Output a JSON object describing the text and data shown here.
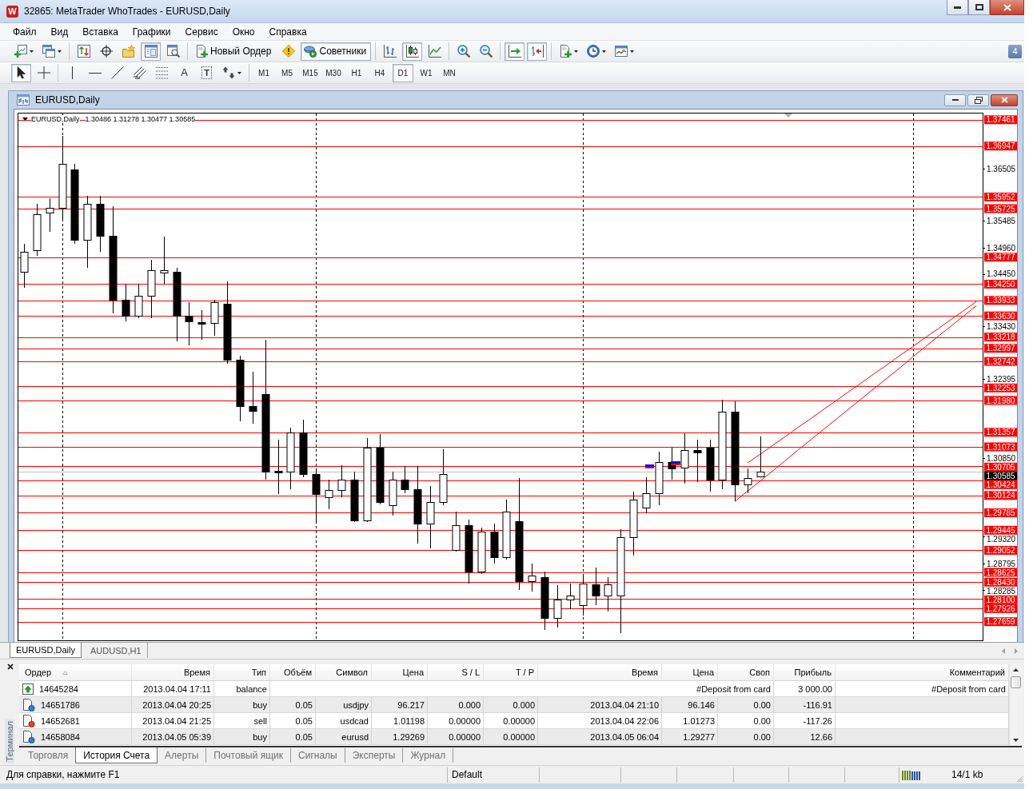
{
  "window": {
    "logo": "W",
    "title": "32865: MetaTrader WhoTrades - EURUSD,Daily"
  },
  "menu": [
    "Файл",
    "Вид",
    "Вставка",
    "Графики",
    "Сервис",
    "Окно",
    "Справка"
  ],
  "toolbar": {
    "groups": [
      [
        {
          "pressed": false
        },
        {
          "pressed": false
        }
      ],
      [
        {
          "pressed": false
        },
        {
          "pressed": false
        },
        {
          "pressed": false
        },
        {
          "pressed": true
        },
        {
          "pressed": false
        }
      ],
      [
        {
          "label": "Новый Ордер",
          "pressed": false
        },
        {
          "pressed": false
        },
        {
          "label": "Советники",
          "pressed": true
        }
      ],
      [
        {
          "pressed": false
        },
        {
          "pressed": true
        },
        {
          "pressed": false
        }
      ],
      [
        {
          "pressed": false
        },
        {
          "pressed": false
        }
      ],
      [
        {
          "pressed": true
        },
        {
          "pressed": true
        }
      ],
      [
        {
          "pressed": false
        },
        {
          "pressed": false
        },
        {
          "pressed": false
        }
      ]
    ],
    "badge": "4"
  },
  "drawing_toolbar": {
    "groups": [
      [
        {
          "pressed": true
        },
        {
          "pressed": false
        }
      ],
      [
        {
          "pressed": false
        },
        {
          "pressed": false
        },
        {
          "pressed": false
        },
        {
          "pressed": false
        },
        {
          "pressed": false
        },
        {
          "glyph": "A",
          "pressed": false
        },
        {
          "glyph": "T",
          "pressed": false
        },
        {
          "pressed": false
        }
      ]
    ],
    "timeframes": [
      {
        "label": "M1",
        "selected": false
      },
      {
        "label": "M5",
        "selected": false
      },
      {
        "label": "M15",
        "selected": false
      },
      {
        "label": "M30",
        "selected": false
      },
      {
        "label": "H1",
        "selected": false
      },
      {
        "label": "H4",
        "selected": false
      },
      {
        "label": "D1",
        "selected": true
      },
      {
        "label": "W1",
        "selected": false
      },
      {
        "label": "MN",
        "selected": false
      }
    ]
  },
  "chart_window": {
    "title": "EURUSD,Daily",
    "chart_data": [
      {
        "type": "candlestick",
        "title": "EURUSD,Daily",
        "subtitle": "1.30486 1.31278 1.30477 1.30585",
        "categories": [
          null,
          null,
          null,
          null,
          null,
          null,
          null,
          null,
          null,
          null,
          null,
          null,
          null,
          null,
          null,
          null,
          null,
          null,
          null,
          null,
          null,
          null,
          null,
          null,
          null,
          null,
          null,
          null,
          null,
          null,
          null,
          null,
          null,
          null,
          null,
          null,
          null,
          null,
          null,
          null,
          null,
          null,
          null,
          null,
          null,
          null,
          null,
          null,
          null,
          null,
          null,
          null,
          null,
          null,
          null,
          null,
          null,
          null,
          null,
          null,
          null,
          null,
          null,
          null,
          null,
          null,
          null,
          null,
          null,
          null,
          null,
          null,
          null,
          null,
          null,
          null
        ],
        "ohlc": [
          [
            1.34491,
            1.35038,
            1.34179,
            1.34882
          ],
          [
            1.34913,
            1.35818,
            1.34804,
            1.35615
          ],
          [
            1.35647,
            1.35928,
            1.35272,
            1.3574
          ],
          [
            1.3574,
            1.37145,
            1.35506,
            1.36599
          ],
          [
            1.3649,
            1.36599,
            1.35038,
            1.35116
          ],
          [
            1.35116,
            1.35974,
            1.3457,
            1.35818
          ],
          [
            1.35818,
            1.35974,
            1.34882,
            1.35194
          ],
          [
            1.35194,
            1.35771,
            1.3368,
            1.33945
          ],
          [
            1.33945,
            1.34257,
            1.33523,
            1.33633
          ],
          [
            1.33633,
            1.34257,
            1.33586,
            1.34023
          ],
          [
            1.34023,
            1.34725,
            1.33586,
            1.34523
          ],
          [
            1.34476,
            1.35178,
            1.34257,
            1.34523
          ],
          [
            1.34491,
            1.3457,
            1.33133,
            1.33633
          ],
          [
            1.33633,
            1.33898,
            1.33055,
            1.33523
          ],
          [
            1.33508,
            1.33742,
            1.33164,
            1.33477
          ],
          [
            1.33492,
            1.33945,
            1.33243,
            1.33898
          ],
          [
            1.33867,
            1.34304,
            1.32696,
            1.32774
          ],
          [
            1.32774,
            1.32852,
            1.31572,
            1.31869
          ],
          [
            1.31869,
            1.3254,
            1.31525,
            1.31775
          ],
          [
            1.32103,
            1.33164,
            1.30433,
            1.30589
          ],
          [
            1.30604,
            1.31213,
            1.30152,
            1.30573
          ],
          [
            1.30589,
            1.31447,
            1.30245,
            1.31354
          ],
          [
            1.31354,
            1.31603,
            1.3048,
            1.30542
          ],
          [
            1.30542,
            1.3062,
            1.29621,
            1.30152
          ],
          [
            1.30089,
            1.30433,
            1.29855,
            1.3023
          ],
          [
            1.3023,
            1.30714,
            1.30089,
            1.30433
          ],
          [
            1.30433,
            1.30589,
            1.29605,
            1.29637
          ],
          [
            1.29637,
            1.31245,
            1.29605,
            1.31057
          ],
          [
            1.31057,
            1.31323,
            1.29949,
            1.29996
          ],
          [
            1.29933,
            1.30589,
            1.2973,
            1.30433
          ],
          [
            1.30433,
            1.30698,
            1.30168,
            1.30245
          ],
          [
            1.30245,
            1.30698,
            1.29184,
            1.29574
          ],
          [
            1.29574,
            1.30308,
            1.2909,
            1.29996
          ],
          [
            1.29996,
            1.31026,
            1.29933,
            1.30542
          ],
          [
            1.29059,
            1.29808,
            1.29028,
            1.29543
          ],
          [
            1.29543,
            1.29652,
            1.28403,
            1.28638
          ],
          [
            1.28638,
            1.29496,
            1.28591,
            1.29418
          ],
          [
            1.29418,
            1.29574,
            1.28794,
            1.28918
          ],
          [
            1.28918,
            1.30043,
            1.28872,
            1.29808
          ],
          [
            1.29621,
            1.30464,
            1.28279,
            1.2845
          ],
          [
            1.2845,
            1.28794,
            1.28247,
            1.2856
          ],
          [
            1.28528,
            1.28638,
            1.27498,
            1.27732
          ],
          [
            1.27732,
            1.28372,
            1.27545,
            1.28091
          ],
          [
            1.28091,
            1.28403,
            1.27904,
            1.28169
          ],
          [
            1.27982,
            1.28591,
            1.27779,
            1.28403
          ],
          [
            1.28388,
            1.28716,
            1.27982,
            1.28169
          ],
          [
            1.28169,
            1.28528,
            1.27857,
            1.28388
          ],
          [
            1.28169,
            1.29465,
            1.27436,
            1.29309
          ],
          [
            1.29309,
            1.30199,
            1.2895,
            1.30043
          ],
          [
            1.29887,
            1.3048,
            1.29777,
            1.30168
          ],
          [
            1.30168,
            1.30979,
            1.29933,
            1.30776
          ],
          [
            1.30776,
            1.31057,
            1.30433,
            1.30651
          ],
          [
            1.30667,
            1.31338,
            1.30355,
            1.3101
          ],
          [
            1.3101,
            1.31213,
            1.30386,
            1.30963
          ],
          [
            1.31057,
            1.31213,
            1.30199,
            1.30433
          ],
          [
            1.30433,
            1.31994,
            1.30245,
            1.3176
          ],
          [
            1.3176,
            1.31963,
            1.30011,
            1.30339
          ],
          [
            1.30339,
            1.30651,
            1.30168,
            1.30464
          ],
          [
            1.30486,
            1.31278,
            1.30477,
            1.30585
          ],
          null,
          null,
          null,
          null,
          null,
          null,
          null,
          null,
          null,
          null,
          null,
          null,
          null,
          null,
          null,
          null,
          null
        ],
        "series": [
          {
            "type": "line",
            "color": "#ff0000",
            "values": [
              null,
              null,
              null,
              null,
              null,
              null,
              null,
              null,
              null,
              null,
              null,
              null,
              null,
              null,
              null,
              null,
              null,
              null,
              null,
              null,
              null,
              null,
              null,
              null,
              null,
              null,
              null,
              null,
              null,
              null,
              null,
              null,
              null,
              null,
              null,
              null,
              null,
              null,
              null,
              null,
              null,
              null,
              null,
              null,
              null,
              null,
              null,
              null,
              null,
              null,
              null,
              null,
              null,
              null,
              null,
              null,
              null,
              1.3076,
              1.3093,
              1.3111,
              1.3128,
              1.3146,
              1.3163,
              1.3181,
              1.3198,
              1.3216,
              1.3233,
              1.3251,
              1.3268,
              1.3286,
              1.3303,
              1.3321,
              1.3338,
              1.3356,
              1.3373,
              1.3391
            ]
          },
          {
            "type": "line",
            "color": "#ff0000",
            "values": [
              null,
              null,
              null,
              null,
              null,
              null,
              null,
              null,
              null,
              null,
              null,
              null,
              null,
              null,
              null,
              null,
              null,
              null,
              null,
              null,
              null,
              null,
              null,
              null,
              null,
              null,
              null,
              null,
              null,
              null,
              null,
              null,
              null,
              null,
              null,
              null,
              null,
              null,
              null,
              null,
              null,
              null,
              null,
              null,
              null,
              null,
              null,
              null,
              null,
              null,
              null,
              null,
              null,
              null,
              null,
              null,
              1.3001,
              1.3021,
              1.3041,
              1.3061,
              1.3081,
              1.3102,
              1.3122,
              1.3142,
              1.3162,
              1.3182,
              1.3202,
              1.3222,
              1.3242,
              1.3262,
              1.3283,
              1.3303,
              1.3323,
              1.3343,
              1.3363,
              1.3383
            ]
          }
        ],
        "ylim": [
          1.27295,
          1.37598
        ],
        "grid": true,
        "yticks": [
          1.36505,
          1.35485,
          {
            "value": 1.3496,
            "label": "1.34960"
          },
          {
            "value": 1.3445,
            "label": "1.34450"
          },
          {
            "value": 1.3343,
            "label": "1.33430"
          },
          1.32395,
          {
            "value": 1.3085,
            "label": "1.30850"
          },
          {
            "value": 1.2932,
            "label": "1.29320"
          },
          1.28795,
          1.28285
        ],
        "ref_lines": [
          {
            "axis": "y",
            "value": 1.37461,
            "label": "1.37461",
            "color": "#ff0000"
          },
          {
            "axis": "y",
            "value": 1.36947,
            "label": "1.36947",
            "color": "#ff0000"
          },
          {
            "axis": "y",
            "value": 1.35952,
            "label": "1.35952",
            "color": "#ff0000"
          },
          {
            "axis": "y",
            "value": 1.35725,
            "label": "1.35725",
            "color": "#ff0000"
          },
          {
            "axis": "y",
            "value": 1.34777,
            "label": "1.34777",
            "color": "#ff0000"
          },
          {
            "axis": "y",
            "value": 1.3425,
            "label": "1.34250",
            "color": "#ff0000"
          },
          {
            "axis": "y",
            "value": 1.33933,
            "label": "1.33933",
            "color": "#ff0000"
          },
          {
            "axis": "y",
            "value": 1.3363,
            "label": "1.33630",
            "color": "#ff0000"
          },
          {
            "axis": "y",
            "value": 1.33218,
            "label": "1.33218",
            "color": "#ff0000"
          },
          {
            "axis": "y",
            "value": 1.32997,
            "label": "1.32997",
            "color": "#ff0000"
          },
          {
            "axis": "y",
            "value": 1.32742,
            "label": "1.32742",
            "color": "#ff0000"
          },
          {
            "axis": "y",
            "value": 1.32253,
            "label": "1.32253",
            "color": "#ff0000"
          },
          {
            "axis": "y",
            "value": 1.3198,
            "label": "1.31980",
            "color": "#ff0000"
          },
          {
            "axis": "y",
            "value": 1.31357,
            "label": "1.31357",
            "color": "#ff0000"
          },
          {
            "axis": "y",
            "value": 1.31073,
            "label": "1.31073",
            "color": "#ff0000"
          },
          {
            "axis": "y",
            "value": 1.30705,
            "label": "1.30705",
            "color": "#ff0000"
          },
          {
            "axis": "y",
            "value": 1.30585,
            "label": "1.30585",
            "color": "#c0c0c0"
          },
          {
            "axis": "y",
            "value": 1.30424,
            "label": "1.30424",
            "color": "#ff0000"
          },
          {
            "axis": "y",
            "value": 1.30124,
            "label": "1.30124",
            "color": "#ff0000"
          },
          {
            "axis": "y",
            "value": 1.29785,
            "label": "1.29785",
            "color": "#ff0000"
          },
          {
            "axis": "y",
            "value": 1.29445,
            "label": "1.29445",
            "color": "#ff0000"
          },
          {
            "axis": "y",
            "value": 1.29052,
            "label": "1.29052",
            "color": "#ff0000"
          },
          {
            "axis": "y",
            "value": 1.28625,
            "label": "1.28625",
            "color": "#ff0000"
          },
          {
            "axis": "y",
            "value": 1.2843,
            "label": "1.28430",
            "color": "#ff0000"
          },
          {
            "axis": "y",
            "value": 1.281,
            "label": "1.28100",
            "color": "#ff0000"
          },
          {
            "axis": "y",
            "value": 1.27926,
            "label": "1.27926",
            "color": "#ff0000"
          },
          {
            "axis": "y",
            "value": 1.27659,
            "label": "1.27659",
            "color": "#ff0000"
          }
        ]
      }
    ]
  },
  "chart_tabs": [
    {
      "label": "EURUSD,Daily",
      "selected": true
    },
    {
      "label": "AUDUSD,H1",
      "selected": false
    }
  ],
  "terminal": {
    "label": "Терминал",
    "columns": [
      {
        "label": "Ордер",
        "sorted": true
      },
      {
        "label": "Время",
        "sorted": false
      },
      {
        "label": "Тип",
        "sorted": false
      },
      {
        "label": "Объём",
        "sorted": false
      },
      {
        "label": "Символ",
        "sorted": false
      },
      {
        "label": "Цена",
        "sorted": false
      },
      {
        "label": "S / L",
        "sorted": false
      },
      {
        "label": "T / P",
        "sorted": false
      },
      {
        "label": "Время",
        "sorted": false
      },
      {
        "label": "Цена",
        "sorted": false
      },
      {
        "label": "Своп",
        "sorted": false
      },
      {
        "label": "Прибыль",
        "sorted": false
      },
      {
        "label": "Комментарий",
        "sorted": false
      }
    ],
    "rows": [
      {
        "kind": "balance",
        "order": "14645284",
        "time": "2013.04.04 17:11",
        "type": "balance",
        "description": "#Deposit from card",
        "profit": "3 000.00",
        "comment": "#Deposit from card"
      },
      {
        "kind": "buy",
        "order": "14651786",
        "open_time": "2013.04.04 20:25",
        "type": "buy",
        "volume": "0.05",
        "symbol": "usdjpy",
        "open_price": "96.217",
        "sl": "0.000",
        "tp": "0.000",
        "close_time": "2013.04.04 21:10",
        "close_price": "96.146",
        "swap": "0.00",
        "profit": "-116.91"
      },
      {
        "kind": "sell",
        "order": "14652681",
        "open_time": "2013.04.04 21:25",
        "type": "sell",
        "volume": "0.05",
        "symbol": "usdcad",
        "open_price": "1.01198",
        "sl": "0.00000",
        "tp": "0.00000",
        "close_time": "2013.04.04 22:06",
        "close_price": "1.01273",
        "swap": "0.00",
        "profit": "-117.26"
      },
      {
        "kind": "buy",
        "order": "14658084",
        "open_time": "2013.04.05 05:39",
        "type": "buy",
        "volume": "0.05",
        "symbol": "eurusd",
        "open_price": "1.29269",
        "sl": "0.00000",
        "tp": "0.00000",
        "close_time": "2013.04.05 06:04",
        "close_price": "1.29277",
        "swap": "0.00",
        "profit": "12.66"
      }
    ],
    "tabs": [
      {
        "label": "Торговля",
        "selected": false
      },
      {
        "label": "История Счета",
        "selected": true
      },
      {
        "label": "Алерты",
        "selected": false
      },
      {
        "label": "Почтовый ящик",
        "selected": false
      },
      {
        "label": "Сигналы",
        "selected": false
      },
      {
        "label": "Эксперты",
        "selected": false
      },
      {
        "label": "Журнал",
        "selected": false
      }
    ]
  },
  "status_bar": {
    "help": "Для справки, нажмите F1",
    "profile": "Default",
    "traffic": "14/1 kb"
  }
}
